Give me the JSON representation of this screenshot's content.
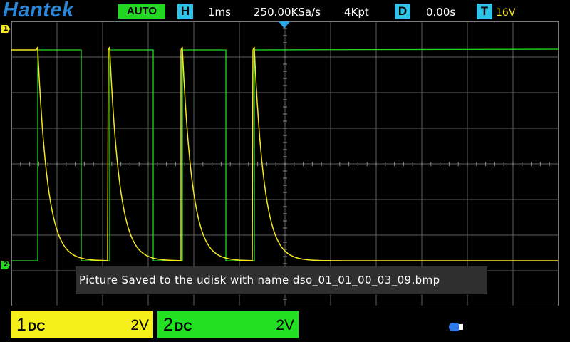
{
  "header": {
    "brand": "Hantek",
    "mode": "AUTO",
    "h_tag": "H",
    "timebase": "1ms",
    "sample_rate": "250.00KSa/s",
    "memory_depth": "4Kpt",
    "d_tag": "D",
    "delay": "0.00s",
    "t_tag": "T",
    "trigger_level": "16V"
  },
  "markers": {
    "ch1": "1",
    "ch2": "2"
  },
  "message": "Picture Saved to the udisk with name dso_01_01_00_03_09.bmp",
  "channels": [
    {
      "num": "1",
      "coupling": "DC",
      "scale": "2V",
      "color": "#f5f01a"
    },
    {
      "num": "2",
      "coupling": "DC",
      "scale": "2V",
      "color": "#22e022"
    }
  ],
  "colors": {
    "ch1": "#f5e81c",
    "ch2": "#22d822",
    "accent": "#2ec3e8",
    "grid": "#6a6a6a"
  },
  "icons": {
    "storage": "usb-drive-icon"
  }
}
